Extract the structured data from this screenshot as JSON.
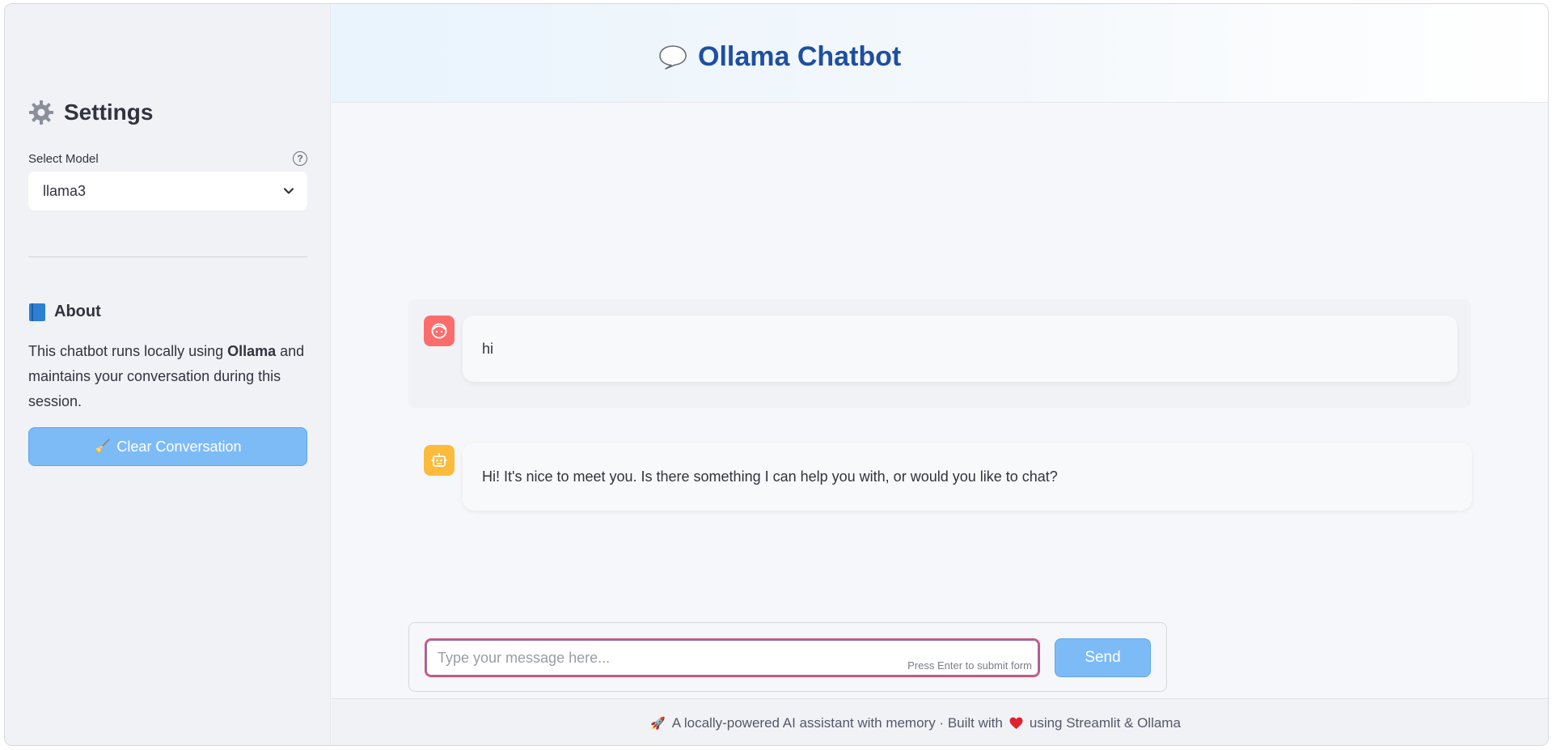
{
  "header": {
    "title": "Ollama Chatbot",
    "icon": "speech-bubble-icon"
  },
  "sidebar": {
    "title": "Settings",
    "title_icon": "gear-icon",
    "model_label": "Select Model",
    "model_value": "llama3",
    "about_title": "About",
    "about_text_1": "This chatbot runs locally using ",
    "about_text_bold": "Ollama",
    "about_text_2": " and maintains your conversation during this session.",
    "clear_button": "Clear Conversation",
    "clear_icon": "🧹"
  },
  "messages": [
    {
      "role": "user",
      "text": "hi"
    },
    {
      "role": "assistant",
      "text": "Hi! It's nice to meet you. Is there something I can help you with, or would you like to chat?"
    }
  ],
  "input": {
    "placeholder": "Type your message here...",
    "hint": "Press Enter to submit form",
    "send_label": "Send"
  },
  "footer": {
    "rocket": "🚀",
    "text_1": "A locally-powered AI assistant with memory · Built with",
    "text_2": "using Streamlit & Ollama"
  },
  "colors": {
    "accent": "#7dbbf7",
    "title": "#1e4fa0",
    "user_avatar": "#fb6d6d",
    "bot_avatar": "#fdbb3c"
  }
}
